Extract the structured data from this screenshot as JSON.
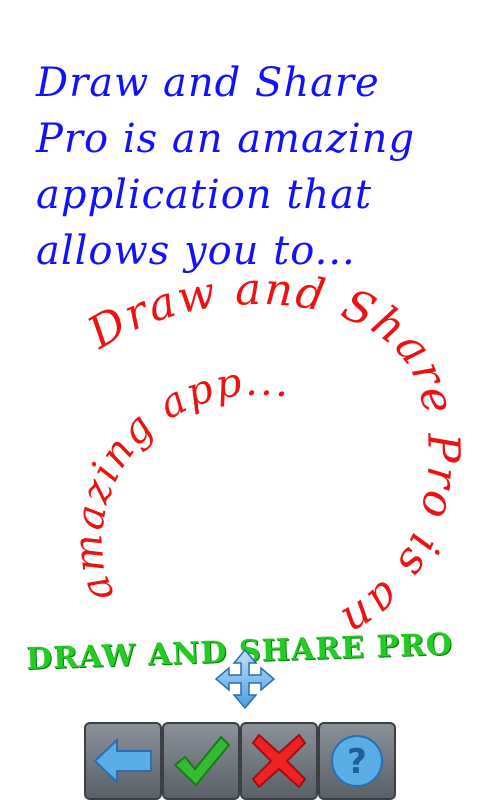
{
  "intro": {
    "lines": [
      "Draw and Share",
      "Pro is an amazing",
      "application that",
      "allows you to..."
    ],
    "color": "#1111ff"
  },
  "spiral": {
    "outer_text": "Draw and Share Pro is an",
    "inner_text": "amazing app...",
    "color": "#ee1111"
  },
  "banner": {
    "text": "DRAW AND SHARE PRO",
    "color": "#22cc22"
  },
  "move_handle": {
    "icon": "move-arrows-icon"
  },
  "toolbar": {
    "buttons": [
      {
        "name": "back-button",
        "icon": "arrow-left-icon",
        "color": "#5aaee8"
      },
      {
        "name": "confirm-button",
        "icon": "check-icon",
        "color": "#33bb33"
      },
      {
        "name": "cancel-button",
        "icon": "close-icon",
        "color": "#ee2222"
      },
      {
        "name": "help-button",
        "icon": "help-icon",
        "color": "#5aaee8"
      }
    ]
  }
}
